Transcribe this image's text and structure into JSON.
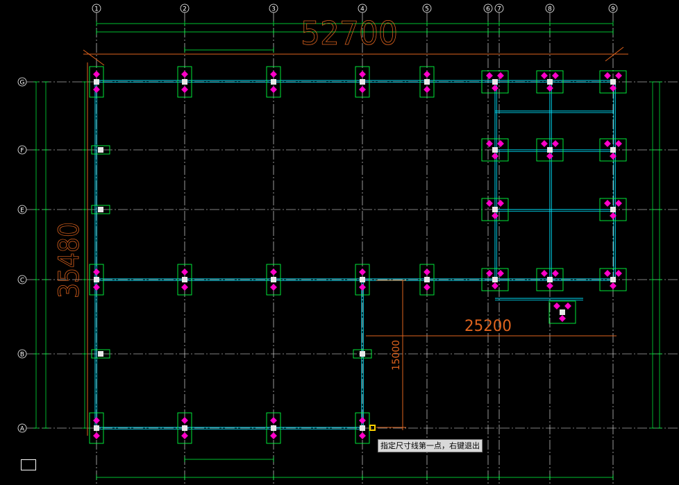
{
  "drawing": {
    "column_axes": [
      "1",
      "2",
      "3",
      "4",
      "5",
      "6",
      "7",
      "8",
      "9"
    ],
    "row_axes": [
      "G",
      "F",
      "E",
      "C",
      "B",
      "A"
    ],
    "overall_width_dim": "52700",
    "overall_height_dim": "35480",
    "partial_width_dim": "25200",
    "partial_height_dim": "15000"
  },
  "command_prompt": "指定尺寸线第一点，右键退出",
  "colors": {
    "background": "#000000",
    "axis_line": "#ffffff",
    "beam": "#00e5ff",
    "footing": "#00ff40",
    "pile": "#ff00c8",
    "dimension_big": "#e0641e",
    "tooltip_bg": "#d9d9d9",
    "osnap_marker": "#ffd200"
  }
}
